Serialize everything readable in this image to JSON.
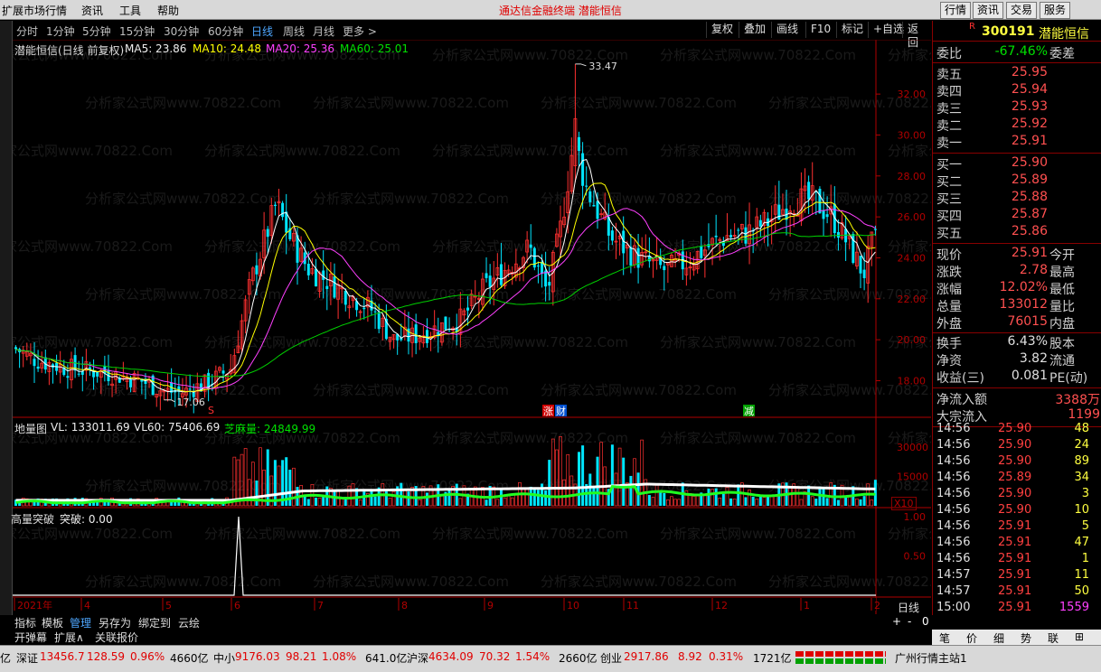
{
  "menu": {
    "items": [
      "扩展市场行情",
      "资讯",
      "工具",
      "帮助"
    ],
    "center_title": "通达信金融终端   潜能恒信",
    "right_buttons": [
      "行情",
      "资讯",
      "交易",
      "服务"
    ]
  },
  "periods": [
    "分时",
    "1分钟",
    "5分钟",
    "15分钟",
    "30分钟",
    "60分钟",
    "日线",
    "周线",
    "月线",
    "更多 >"
  ],
  "active_period": "日线",
  "toolbar": [
    "复权",
    "叠加",
    "画线",
    "F10",
    "标记",
    "+自选",
    "返回"
  ],
  "chart_header": {
    "name": "潜能恒信(日线 前复权)",
    "ma5": "MA5: 23.86",
    "ma10": "MA10: 24.48",
    "ma20": "MA20: 25.36",
    "ma60": "MA60: 25.01"
  },
  "price_axis": [
    "32.00",
    "30.00",
    "28.00",
    "26.00",
    "24.00",
    "22.00",
    "20.00",
    "18.00"
  ],
  "price_marks": {
    "high": "33.47",
    "low": "17.06"
  },
  "event_marks": {
    "s": "S",
    "zhang": "涨",
    "cai": "财",
    "jian": "减"
  },
  "volume_header": {
    "name": "地量图",
    "vl": "VL: 133011.69",
    "vl60": "VL60: 75406.69",
    "zhima": "芝麻量: 24849.99"
  },
  "volume_axis": [
    "30000",
    "15000"
  ],
  "volume_unit": "X10",
  "ind_header": {
    "name": "高量突破",
    "val": "突破: 0.00"
  },
  "ind_axis": [
    "1.00",
    "0.50"
  ],
  "date_axis": [
    "2021年",
    "4",
    "5",
    "6",
    "7",
    "8",
    "9",
    "10",
    "11",
    "12",
    "1",
    "2"
  ],
  "period_label": "日线",
  "zoom": [
    "+",
    "-",
    "0"
  ],
  "watermark": "分析家公式网www.70822.Com",
  "right_panel": {
    "code": "300191",
    "name": "潜能恒信",
    "r_mark": "R",
    "weibi": {
      "label": "委比",
      "value": "-67.46%",
      "label2": "委差"
    },
    "sells": [
      {
        "l": "卖五",
        "v": "25.95"
      },
      {
        "l": "卖四",
        "v": "25.94"
      },
      {
        "l": "卖三",
        "v": "25.93"
      },
      {
        "l": "卖二",
        "v": "25.92"
      },
      {
        "l": "卖一",
        "v": "25.91"
      }
    ],
    "buys": [
      {
        "l": "买一",
        "v": "25.90"
      },
      {
        "l": "买二",
        "v": "25.89"
      },
      {
        "l": "买三",
        "v": "25.88"
      },
      {
        "l": "买四",
        "v": "25.87"
      },
      {
        "l": "买五",
        "v": "25.86"
      }
    ],
    "stats": [
      {
        "l": "现价",
        "v": "25.91",
        "l2": "今开"
      },
      {
        "l": "涨跌",
        "v": "2.78",
        "l2": "最高"
      },
      {
        "l": "涨幅",
        "v": "12.02%",
        "l2": "最低"
      },
      {
        "l": "总量",
        "v": "133012",
        "l2": "量比"
      },
      {
        "l": "外盘",
        "v": "76015",
        "l2": "内盘"
      },
      {
        "l": "换手",
        "v": "6.43%",
        "l2": "股本"
      },
      {
        "l": "净资",
        "v": "3.82",
        "l2": "流通"
      },
      {
        "l": "收益(三)",
        "v": "0.081",
        "l2": "PE(动)"
      }
    ],
    "flows": [
      {
        "l": "净流入额",
        "v": "3388万"
      },
      {
        "l": "大宗流入",
        "v": "1199"
      }
    ],
    "ticks": [
      {
        "t": "14:56",
        "p": "25.90",
        "v": "48"
      },
      {
        "t": "14:56",
        "p": "25.90",
        "v": "24"
      },
      {
        "t": "14:56",
        "p": "25.90",
        "v": "89"
      },
      {
        "t": "14:56",
        "p": "25.89",
        "v": "34"
      },
      {
        "t": "14:56",
        "p": "25.90",
        "v": "3"
      },
      {
        "t": "14:56",
        "p": "25.90",
        "v": "10"
      },
      {
        "t": "14:56",
        "p": "25.91",
        "v": "5"
      },
      {
        "t": "14:56",
        "p": "25.91",
        "v": "47"
      },
      {
        "t": "14:56",
        "p": "25.91",
        "v": "1"
      },
      {
        "t": "14:57",
        "p": "25.91",
        "v": "11"
      },
      {
        "t": "14:57",
        "p": "25.91",
        "v": "50"
      },
      {
        "t": "15:00",
        "p": "25.91",
        "v": "1559"
      }
    ],
    "tabs": [
      "笔",
      "价",
      "细",
      "势",
      "联",
      "⊞"
    ]
  },
  "bottom_tabs": [
    "指标",
    "模板",
    "管理",
    "另存为",
    "绑定到",
    "云绘"
  ],
  "ext_tabs": [
    "开弹幕",
    "扩展∧",
    "关联报价"
  ],
  "status": [
    {
      "name": "深证",
      "val": "13456.7",
      "chg": "128.59",
      "pct": "0.96%",
      "amt": "4660亿"
    },
    {
      "name": "中小",
      "val": "9176.03",
      "chg": "98.21",
      "pct": "1.08%",
      "amt": "641.0亿"
    },
    {
      "name": "沪深",
      "val": "4634.09",
      "chg": "70.32",
      "pct": "1.54%",
      "amt": "2660亿"
    },
    {
      "name": "创业",
      "val": "2917.86",
      "chg": "8.92",
      "pct": "0.31%",
      "amt": "1721亿"
    }
  ],
  "status_left": "亿",
  "status_right": "广州行情主站1",
  "colors": {
    "up": "#ff3030",
    "down": "#00e5ff",
    "ma5": "#ffffff",
    "ma10": "#ffff00",
    "ma20": "#ff40ff",
    "ma60": "#00d000",
    "bg": "#000000",
    "axis": "#b00000"
  }
}
